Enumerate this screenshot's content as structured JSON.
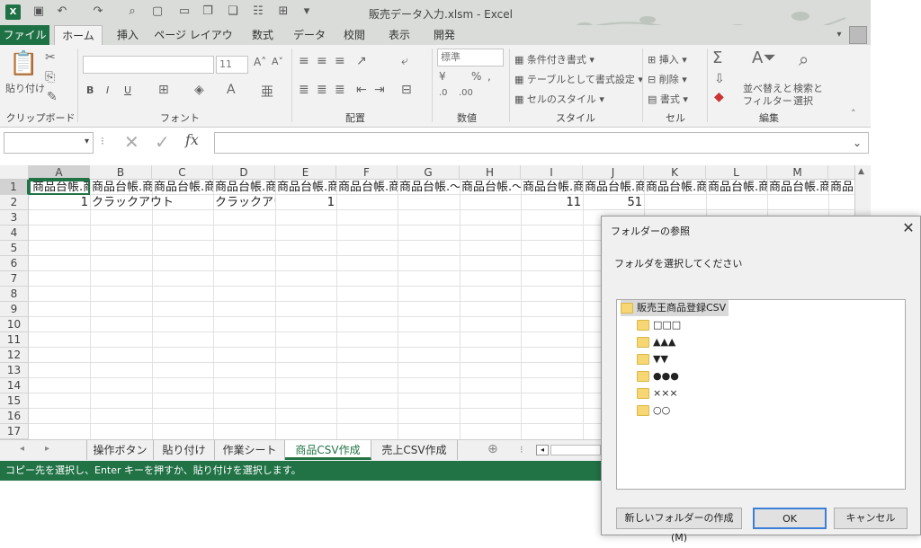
{
  "window": {
    "title": "販売データ入力.xlsm - Excel",
    "app_badge": "X"
  },
  "ribbon_tabs": [
    "ファイル",
    "ホーム",
    "挿入",
    "ページ レイアウト",
    "数式",
    "データ",
    "校閲",
    "表示",
    "開発"
  ],
  "ribbon": {
    "clipboard": {
      "label": "クリップボード",
      "paste": "貼り付け"
    },
    "font": {
      "label": "フォント",
      "size": "11",
      "bold": "B",
      "italic": "I",
      "underline": "U"
    },
    "alignment": {
      "label": "配置"
    },
    "number": {
      "label": "数値",
      "format": "標準"
    },
    "styles": {
      "label": "スタイル",
      "conditional": "条件付き書式",
      "table": "テーブルとして書式設定",
      "cell_style": "セルのスタイル"
    },
    "cells": {
      "label": "セル",
      "insert": "挿入",
      "delete": "削除",
      "format": "書式"
    },
    "editing": {
      "label": "編集",
      "sort": "並べ替えと",
      "filter": "フィルター",
      "find": "検索と",
      "select": "選択"
    }
  },
  "formula_bar": {
    "name_box": "",
    "fx": "fx",
    "formula": ""
  },
  "columns": [
    "A",
    "B",
    "C",
    "D",
    "E",
    "F",
    "G",
    "H",
    "I",
    "J",
    "K",
    "L",
    "M"
  ],
  "rows": [
    "1",
    "2",
    "3",
    "4",
    "5",
    "6",
    "7",
    "8",
    "9",
    "10",
    "11",
    "12",
    "13",
    "14",
    "15",
    "16",
    "17"
  ],
  "row1": [
    "商品台帳.商",
    "商品台帳.商",
    "商品台帳.商",
    "商品台帳.商",
    "商品台帳.商",
    "商品台帳.商",
    "商品台帳.〜",
    "商品台帳.〜",
    "商品台帳.商",
    "商品台帳.商",
    "商品台帳.商",
    "商品台帳.商",
    "商品台帳.商",
    "商品"
  ],
  "row2": {
    "A": "1",
    "B": "クラックアウト",
    "D": "クラックアウ",
    "E": "1",
    "I": "11",
    "J": "51"
  },
  "sheet_tabs": [
    "操作ボタン",
    "貼り付け",
    "作業シート",
    "商品CSV作成",
    "売上CSV作成"
  ],
  "active_sheet": "商品CSV作成",
  "status": "コピー先を選択し、Enter キーを押すか、貼り付けを選択します。",
  "dialog": {
    "title": "フォルダーの参照",
    "message": "フォルダを選択してください",
    "root": "販売王商品登録CSV",
    "children": [
      "□□□",
      "▲▲▲",
      "▼▼",
      "●●●",
      "×××",
      "○○"
    ],
    "new_folder": "新しいフォルダーの作成(M)",
    "ok": "OK",
    "cancel": "キャンセル"
  },
  "colors": {
    "excel_green": "#217346",
    "ribbon_bg": "#f2f2f2",
    "title_bg": "#d9dcd9"
  }
}
